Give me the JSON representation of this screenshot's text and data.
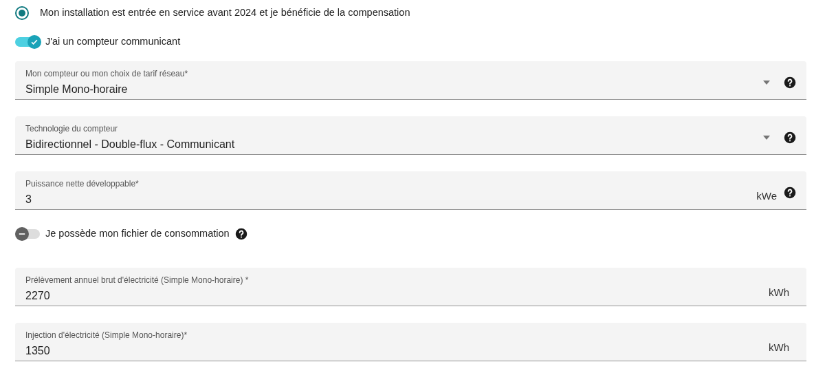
{
  "items": [
    {
      "kind": "radio",
      "label": "Mon installation est entrée en service avant 2024 et je bénéficie de la compensation",
      "selected": true
    },
    {
      "kind": "switch",
      "label": "J'ai un compteur communicant",
      "on": true,
      "help": false
    },
    {
      "kind": "select",
      "label": "Mon compteur ou mon choix de tarif réseau*",
      "value": "Simple Mono-horaire",
      "help": true
    },
    {
      "kind": "select",
      "label": "Technologie du compteur",
      "value": "Bidirectionnel - Double-flux - Communicant",
      "help": true
    },
    {
      "kind": "input",
      "label": "Puissance nette développable*",
      "value": "3",
      "suffix": "kWe",
      "help": true
    },
    {
      "kind": "switch",
      "label": "Je possède mon fichier de consommation",
      "on": false,
      "help": true
    },
    {
      "kind": "input",
      "label": "Prélèvement annuel brut d'électricité (Simple Mono-horaire) *",
      "value": "2270",
      "suffix": "kWh",
      "help": false
    },
    {
      "kind": "input",
      "label": "Injection d'électricité (Simple Mono-horaire)*",
      "value": "1350",
      "suffix": "kWh",
      "help": false
    }
  ]
}
